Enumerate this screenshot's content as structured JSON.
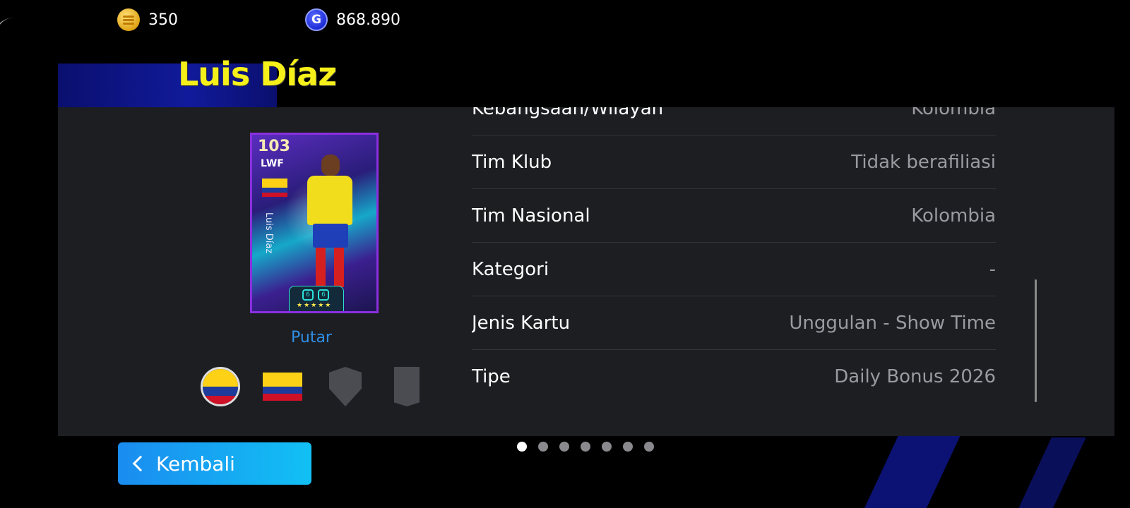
{
  "currency": {
    "coins": {
      "icon": "ecoin-icon",
      "value": "350"
    },
    "gp": {
      "icon": "gp-icon",
      "value": "868.890",
      "symbol": "G"
    }
  },
  "player": {
    "name": "Luis Díaz",
    "card": {
      "rating": "103",
      "position": "LWF",
      "vertical_name": "Luis Díaz",
      "stars": "★★★★★",
      "badge_left": "6",
      "badge_right": "6"
    },
    "flip_label": "Putar"
  },
  "info": {
    "rows": [
      {
        "label": "Kebangsaan/Wilayah",
        "value": "Kolombia"
      },
      {
        "label": "Tim Klub",
        "value": "Tidak berafiliasi"
      },
      {
        "label": "Tim Nasional",
        "value": "Kolombia"
      },
      {
        "label": "Kategori",
        "value": "-"
      },
      {
        "label": "Jenis Kartu",
        "value": "Unggulan - Show Time"
      },
      {
        "label": "Tipe",
        "value": "Daily Bonus 2026"
      }
    ]
  },
  "navigation": {
    "back_label": "Kembali",
    "page_count": 7,
    "active_page": 1
  },
  "colors": {
    "name": "#f6f01a",
    "link": "#2f8fe6",
    "panel": "#1d1e22",
    "back_button": "#1a8cf0"
  }
}
